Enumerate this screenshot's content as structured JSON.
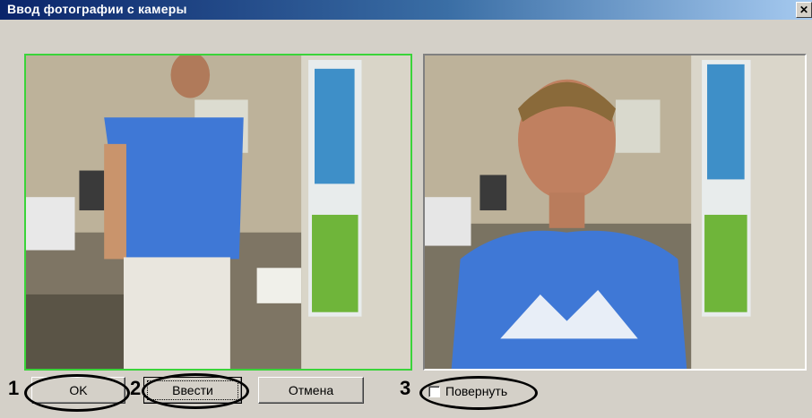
{
  "window": {
    "title": "Ввод фотографии с камеры",
    "close_icon": "close-icon"
  },
  "buttons": {
    "ok_label": "OK",
    "enter_label": "Ввести",
    "cancel_label": "Отмена"
  },
  "rotate": {
    "label": "Повернуть",
    "checked": false
  },
  "callouts": {
    "one": "1",
    "two": "2",
    "three": "3"
  },
  "colors": {
    "title_start": "#0a246a",
    "title_end": "#a6caf0",
    "live_border": "#3ad43a",
    "face": "#d4d0c8"
  }
}
